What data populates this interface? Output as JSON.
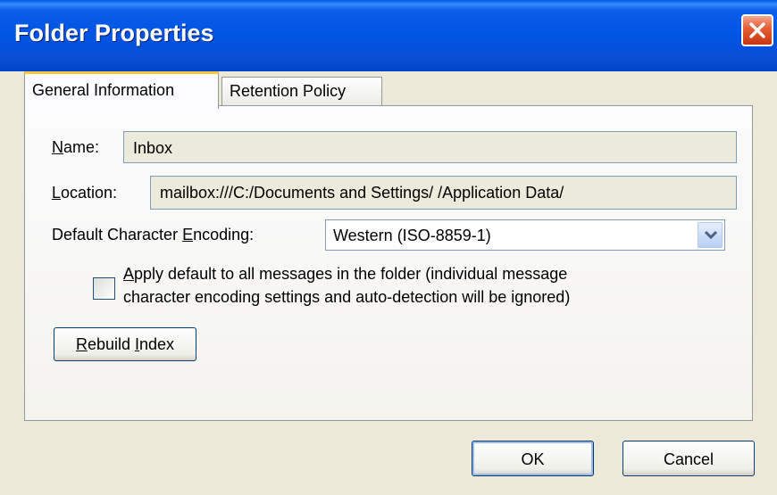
{
  "window": {
    "title": "Folder Properties",
    "close_icon": "close-icon"
  },
  "tabs": [
    {
      "label": "General Information",
      "active": true
    },
    {
      "label": "Retention Policy",
      "active": false
    }
  ],
  "general": {
    "name_label": "Name:",
    "name_value": "Inbox",
    "location_label": "Location:",
    "location_value": "mailbox:///C:/Documents and Settings/    /Application Data/",
    "encoding_label": "Default Character Encoding:",
    "encoding_value": "Western (ISO-8859-1)",
    "apply_default_line1": "Apply default to all messages in the folder (individual message",
    "apply_default_line2": "character encoding settings and auto-detection will be ignored)",
    "apply_default_checked": false,
    "rebuild_label": "Rebuild Index"
  },
  "footer": {
    "ok_label": "OK",
    "cancel_label": "Cancel"
  },
  "colors": {
    "titlebar": "#0054e3",
    "dialog_bg": "#ece9d8",
    "close_button": "#e35b32",
    "tab_highlight": "#ffc83c"
  }
}
